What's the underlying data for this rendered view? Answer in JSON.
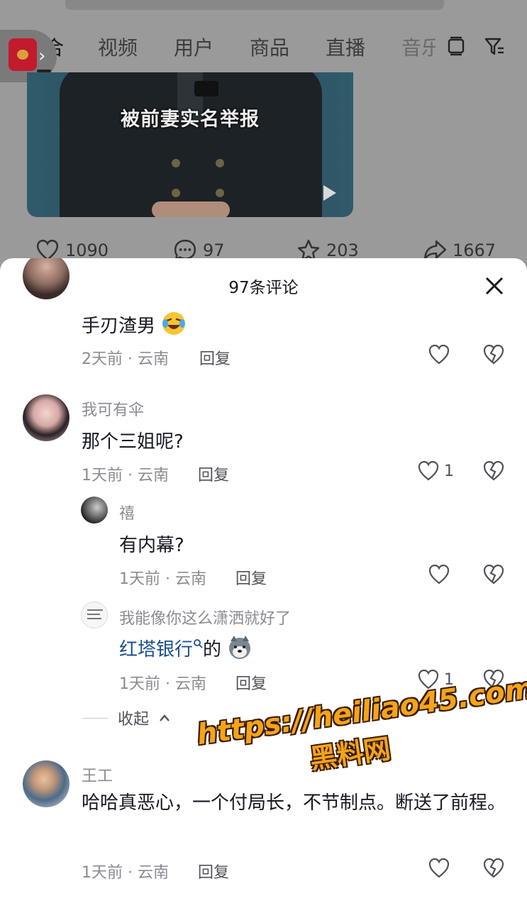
{
  "tabs": [
    {
      "label": "综合"
    },
    {
      "label": "视频"
    },
    {
      "label": "用户"
    },
    {
      "label": "商品"
    },
    {
      "label": "直播"
    },
    {
      "label": "音乐"
    }
  ],
  "video": {
    "caption": "被前妻实名举报"
  },
  "stats": {
    "likes": "1090",
    "comments": "97",
    "favorites": "203",
    "shares": "1667"
  },
  "sheet": {
    "title": "97条评论",
    "reply_label": "回复",
    "collapse_label": "收起"
  },
  "comments": [
    {
      "username": "",
      "text": "手刃渣男",
      "meta": "2天前 · 云南",
      "likes": ""
    },
    {
      "username": "我可有伞",
      "text": "那个三姐呢?",
      "meta": "1天前 · 云南",
      "likes": "1"
    },
    {
      "username": "禧",
      "text": "有内幕?",
      "meta": "1天前 · 云南",
      "likes": ""
    },
    {
      "username": "我能像你这么潇洒就好了",
      "link_text": "红塔银行",
      "text_after": "的",
      "meta": "1天前 · 云南",
      "likes": "1"
    },
    {
      "username": "王工",
      "text": "哈哈真恶心，一个付局长，不节制点。断送了前程。",
      "meta": "1天前 · 云南",
      "likes": ""
    }
  ],
  "watermark": {
    "url": "https://heiliao45.com",
    "name": "黑料网"
  }
}
